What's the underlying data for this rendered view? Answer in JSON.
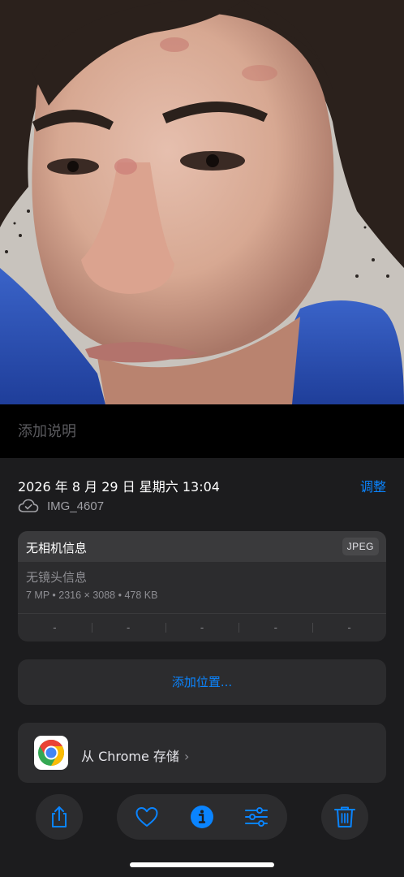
{
  "caption": {
    "placeholder": "添加说明"
  },
  "info": {
    "datetime": "2026 年 8 月 29 日 星期六 13:04",
    "adjust_label": "调整",
    "filename": "IMG_4607",
    "cloud_icon": "cloud-check-icon"
  },
  "exif": {
    "camera": "无相机信息",
    "format_badge": "JPEG",
    "lens": "无镜头信息",
    "specs": "7 MP  •  2316 × 3088  •  478 KB",
    "cells": [
      "-",
      "-",
      "-",
      "-",
      "-"
    ]
  },
  "location": {
    "label": "添加位置..."
  },
  "source": {
    "label": "从 Chrome 存储",
    "chevron": "›",
    "icon": "chrome-icon"
  },
  "toolbar": {
    "share_icon": "share-icon",
    "favorite_icon": "heart-icon",
    "info_icon": "info-icon",
    "edit_icon": "sliders-icon",
    "delete_icon": "trash-icon"
  },
  "colors": {
    "accent": "#0a84ff",
    "panel_bg": "#1c1c1e",
    "card_bg": "#2c2c2e",
    "secondary_text": "#8e8e93"
  }
}
